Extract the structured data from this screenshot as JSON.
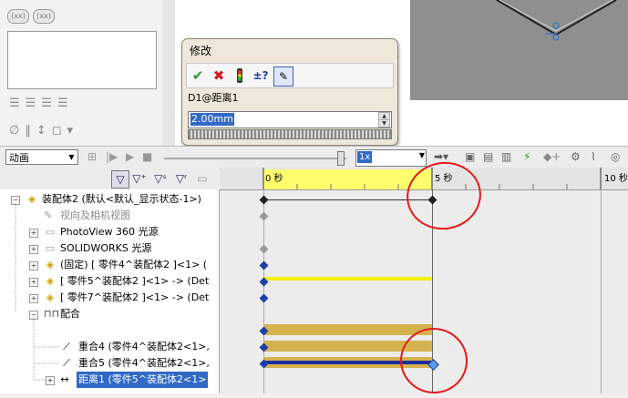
{
  "property_panel": {
    "pill_left": "(xx)",
    "pill_right": "(xx)"
  },
  "modify_dialog": {
    "title": "修改",
    "dimension_name": "D1@距离1",
    "value": "2.00mm",
    "buttons": [
      "ok-check",
      "cancel-x",
      "rebuild-light",
      "plus-minus",
      "mark-dimension"
    ]
  },
  "motion_toolbar": {
    "study_type": "动画",
    "playback_speed": "1x"
  },
  "timeline": {
    "labels": [
      "0 秒",
      "5 秒",
      "10 秒"
    ],
    "current_time_seconds": 5
  },
  "tree": {
    "items": [
      {
        "label": "装配体2 (默认<默认_显示状态-1>)",
        "level": 0
      },
      {
        "label": "视向及相机视图",
        "level": 1
      },
      {
        "label": "PhotoView 360 光源",
        "level": 1
      },
      {
        "label": "SOLIDWORKS 光源",
        "level": 1
      },
      {
        "label": "(固定) [ 零件4^装配体2 ]<1> (",
        "level": 1
      },
      {
        "label": "[ 零件5^装配体2 ]<1> -> (Det",
        "level": 1
      },
      {
        "label": "[ 零件7^装配体2 ]<1> -> (Det",
        "level": 1
      },
      {
        "label": "配合",
        "level": 1
      },
      {
        "label": "重合4 (零件4^装配体2<1>,",
        "level": 2
      },
      {
        "label": "重合5 (零件4^装配体2<1>,",
        "level": 2
      },
      {
        "label": "距离1 (零件5^装配体2<1>",
        "level": 2
      }
    ]
  },
  "colors": {
    "key_blue": "#1a3fa8",
    "key_gray": "#9a9a9a",
    "bar_yellow": "#f5f20a",
    "bar_gold": "#d6b24f",
    "bar_navy": "#1a2f9e",
    "annotation_red": "#e41a1a",
    "selection_blue": "#3169c6"
  }
}
